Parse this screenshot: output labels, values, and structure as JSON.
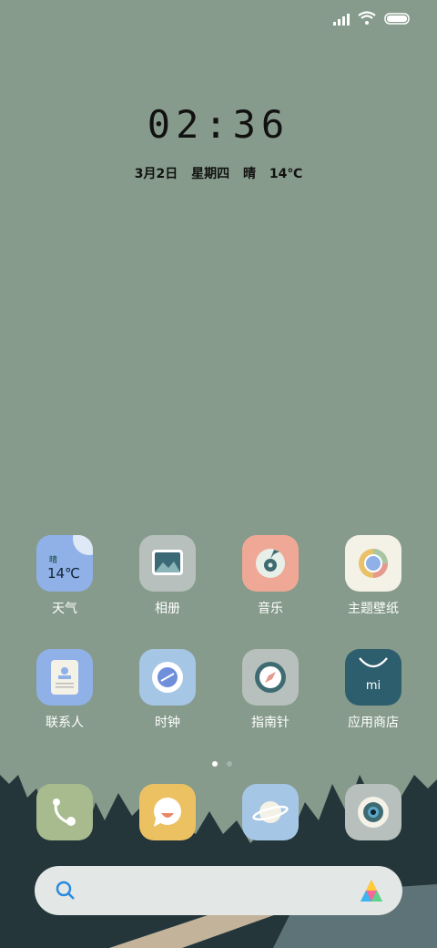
{
  "status": {
    "signal_icon": "signal-icon",
    "wifi_icon": "wifi-icon",
    "battery_icon": "battery-icon"
  },
  "clock": {
    "time": "02:36"
  },
  "date": {
    "date": "3月2日",
    "weekday": "星期四",
    "weather": "晴",
    "temp": "14℃"
  },
  "apps_row1": [
    {
      "label": "天气",
      "widget_text": "晴",
      "widget_temp": "14℃"
    },
    {
      "label": "相册"
    },
    {
      "label": "音乐"
    },
    {
      "label": "主题壁纸"
    }
  ],
  "apps_row2": [
    {
      "label": "联系人"
    },
    {
      "label": "时钟"
    },
    {
      "label": "指南针"
    },
    {
      "label": "应用商店"
    }
  ],
  "dock": {
    "phone": "phone-icon",
    "messages": "messages-icon",
    "browser": "browser-icon",
    "camera": "camera-icon"
  },
  "page_indicator": {
    "pages": 2,
    "current": 1
  },
  "search": {
    "icon": "search-icon",
    "assistant_icon": "assistant-icon"
  },
  "colors": {
    "wallpaper": "#869b8b",
    "trees": "#24363a",
    "label": "#ffffff"
  }
}
